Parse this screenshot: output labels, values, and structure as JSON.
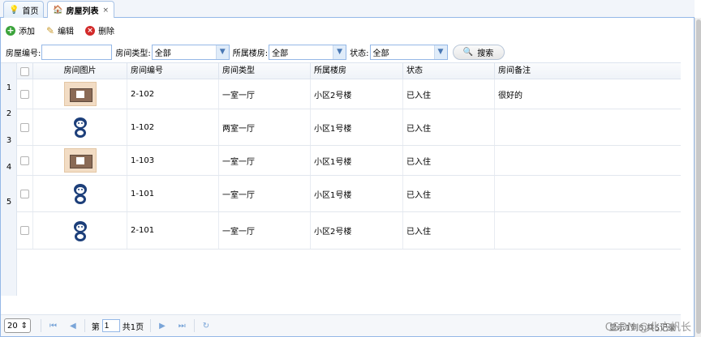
{
  "tabs": [
    {
      "label": "首页",
      "icon": "lightbulb-icon"
    },
    {
      "label": "房屋列表",
      "icon": "house-icon",
      "close": "×"
    }
  ],
  "toolbar": {
    "add": "添加",
    "edit": "编辑",
    "delete": "删除"
  },
  "filter": {
    "room_no_label": "房屋编号:",
    "room_no_value": "",
    "type_label": "房间类型:",
    "type_value": "全部",
    "building_label": "所属楼房:",
    "building_value": "全部",
    "status_label": "状态:",
    "status_value": "全部",
    "search_label": "搜索"
  },
  "grid": {
    "columns": [
      "房间图片",
      "房间编号",
      "房间类型",
      "所属楼房",
      "状态",
      "房间备注"
    ],
    "row_numbers": [
      "1",
      "2",
      "3",
      "4",
      "5"
    ],
    "rows": [
      {
        "image": "room-photo",
        "no": "2-102",
        "type": "一室一厅",
        "building": "小区2号楼",
        "status": "已入住",
        "note": "很好的"
      },
      {
        "image": "monkey-logo",
        "no": "1-102",
        "type": "两室一厅",
        "building": "小区1号楼",
        "status": "已入住",
        "note": ""
      },
      {
        "image": "room-photo",
        "no": "1-103",
        "type": "一室一厅",
        "building": "小区1号楼",
        "status": "已入住",
        "note": ""
      },
      {
        "image": "monkey-logo",
        "no": "1-101",
        "type": "一室一厅",
        "building": "小区1号楼",
        "status": "已入住",
        "note": ""
      },
      {
        "image": "monkey-logo",
        "no": "2-101",
        "type": "一室一厅",
        "building": "小区2号楼",
        "status": "已入住",
        "note": ""
      }
    ]
  },
  "pager": {
    "page_size": "20",
    "page_prefix": "第",
    "page_value": "1",
    "page_total": "共1页",
    "info": "显示1到5,共5记录"
  },
  "watermark": "CSDN @北方帆长"
}
